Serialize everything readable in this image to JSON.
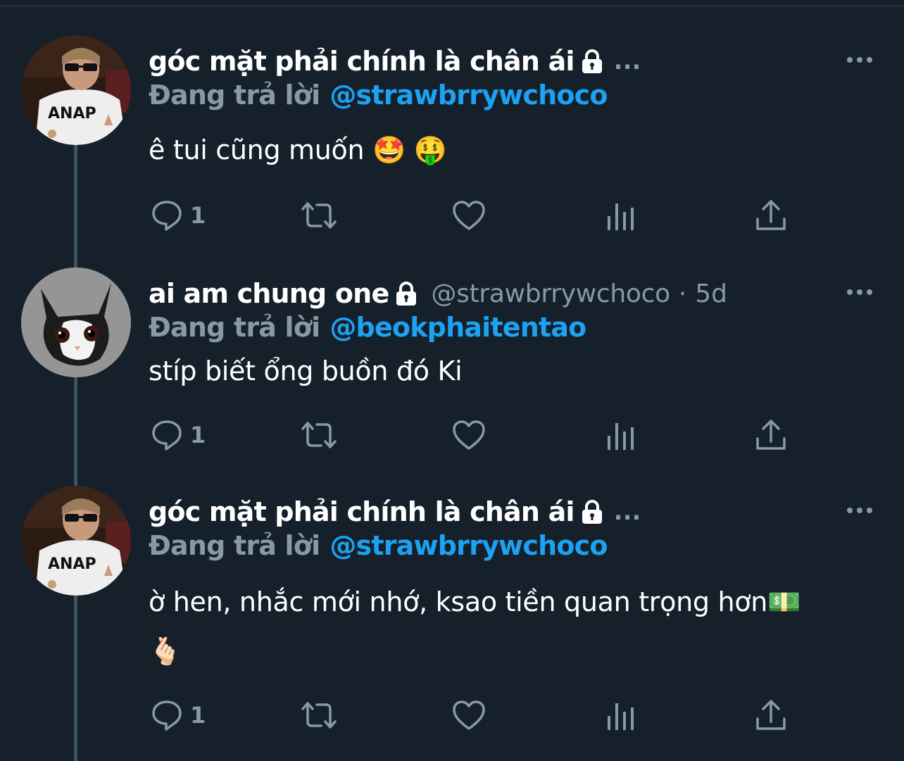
{
  "tweets": [
    {
      "avatar": "avatar-boy-sunglasses",
      "display_name": "góc mặt phải chính là chân ái",
      "name_ellipsis": "...",
      "handle": "",
      "separator": "",
      "time": "",
      "reply_prefix": "Đang trả lời",
      "reply_to": "@strawbrrywchoco",
      "text_lines": [
        "ê tui cũng muốn 🤩 🤑"
      ],
      "reply_count": "1"
    },
    {
      "avatar": "avatar-cat",
      "display_name": "ai am chung one",
      "name_ellipsis": "",
      "handle": "@strawbrrywchoco",
      "separator": "·",
      "time": "5d",
      "reply_prefix": "Đang trả lời",
      "reply_to": "@beokphaitentao",
      "text_lines": [
        "stíp biết ổng buồn đó Ki"
      ],
      "reply_count": "1"
    },
    {
      "avatar": "avatar-boy-sunglasses",
      "display_name": "góc mặt phải chính là chân ái",
      "name_ellipsis": "...",
      "handle": "",
      "separator": "",
      "time": "",
      "reply_prefix": "Đang trả lời",
      "reply_to": "@strawbrrywchoco",
      "text_lines": [
        "ờ hen, nhắc mới nhớ, ksao tiền quan trọng hơn💵",
        "🫰🏻"
      ],
      "reply_count": "1"
    }
  ],
  "icons": {
    "lock": "lock-icon",
    "more": "more-icon",
    "reply": "reply-icon",
    "retweet": "retweet-icon",
    "like": "heart-icon",
    "analytics": "analytics-icon",
    "share": "share-icon"
  },
  "colors": {
    "background": "#15202b",
    "secondary_text": "#8899a6",
    "link": "#1da1f2",
    "thread_line": "#3d5466"
  }
}
